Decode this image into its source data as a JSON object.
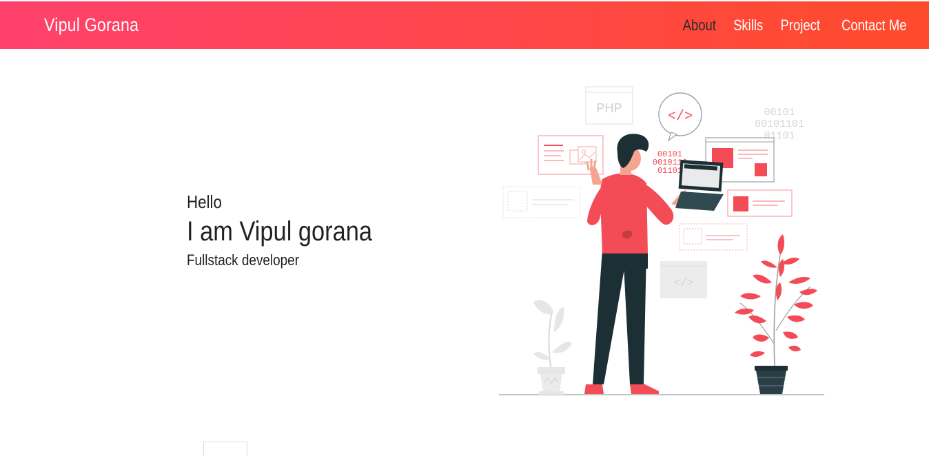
{
  "navbar": {
    "brand": "Vipul Gorana",
    "links": [
      {
        "label": "About",
        "active": true
      },
      {
        "label": "Skills",
        "active": false
      },
      {
        "label": "Project",
        "active": false
      },
      {
        "label": "Contact Me",
        "active": false
      }
    ],
    "gradient_start": "#ff416c",
    "gradient_end": "#ff4b2b"
  },
  "hero": {
    "greeting": "Hello",
    "name": "I am Vipul gorana",
    "role": "Fullstack developer"
  },
  "illustration": {
    "php_label": "PHP",
    "binary_light": [
      "00101",
      "00101101",
      "01101"
    ],
    "binary_red": [
      "00101",
      "0010110",
      "01101"
    ],
    "accent": "#f34c56",
    "dark": "#1c2f35"
  }
}
